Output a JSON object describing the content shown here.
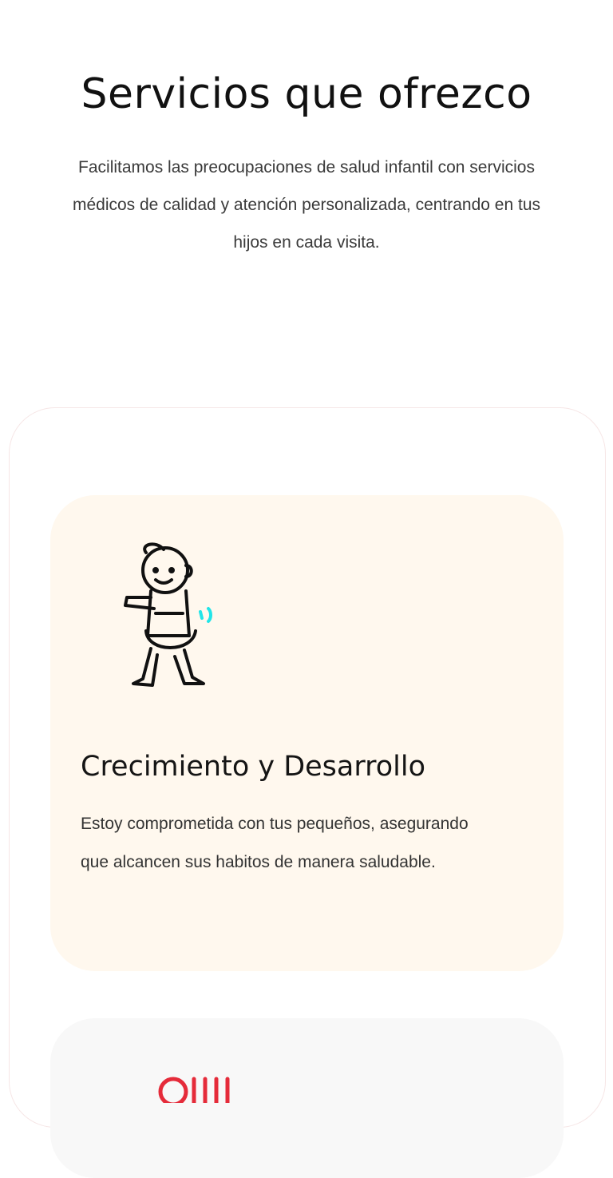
{
  "hero": {
    "title": "Servicios que ofrezco",
    "subtitle": "Facilitamos las preocupaciones de salud infantil con servicios médicos de calidad y atención personalizada, centrando en tus hijos en cada visita."
  },
  "services": [
    {
      "title": "Crecimiento y Desarrollo",
      "description": "Estoy comprometida con tus pequeños, asegurando que alcancen sus habitos de manera saludable.",
      "icon": "baby-walking-icon"
    },
    {
      "icon": "medical-service-icon"
    }
  ],
  "colors": {
    "card_growth_bg": "#fff8ee",
    "card_next_bg": "#f8f8f8",
    "panel_border": "#f6e6e6",
    "accent_cyan": "#22e5e8",
    "accent_red": "#e52b3a"
  }
}
